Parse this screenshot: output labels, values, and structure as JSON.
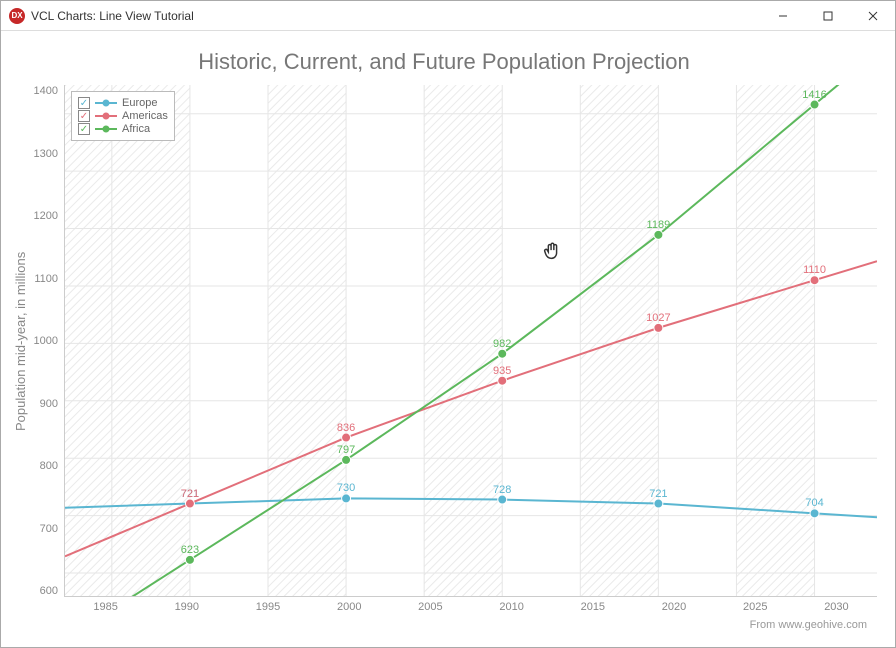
{
  "window": {
    "title": "VCL Charts: Line View Tutorial",
    "app_icon_text": "DX"
  },
  "chart_data": {
    "type": "line",
    "title": "Historic, Current, and Future Population Projection",
    "ylabel": "Population mid-year, in millions",
    "xlabel": "",
    "x": [
      1990,
      2000,
      2010,
      2020,
      2030
    ],
    "series": [
      {
        "name": "Europe",
        "color": "#5ab6d1",
        "values": [
          721,
          730,
          728,
          721,
          704
        ]
      },
      {
        "name": "Americas",
        "color": "#e26f7a",
        "values": [
          721,
          836,
          935,
          1027,
          1110
        ]
      },
      {
        "name": "Africa",
        "color": "#5cb85c",
        "values": [
          623,
          797,
          982,
          1189,
          1416
        ]
      }
    ],
    "x_ticks": [
      1985,
      1990,
      1995,
      2000,
      2005,
      2010,
      2015,
      2020,
      2025,
      2030
    ],
    "y_ticks": [
      600,
      700,
      800,
      900,
      1000,
      1100,
      1200,
      1300,
      1400
    ],
    "xlim": [
      1982,
      2034
    ],
    "ylim": [
      560,
      1450
    ],
    "data_labels": {
      "Europe": {
        "1990": "721",
        "2000": "730",
        "2010": "728",
        "2020": "721",
        "2030": "704"
      },
      "Americas": {
        "1990": "721",
        "2000": "836",
        "2010": "935",
        "2020": "1027",
        "2030": "1110"
      },
      "Africa": {
        "1990": "623",
        "2000": "797",
        "2010": "982",
        "2020": "1189",
        "2030": "1416"
      }
    },
    "source_text": "From www.geohive.com"
  }
}
